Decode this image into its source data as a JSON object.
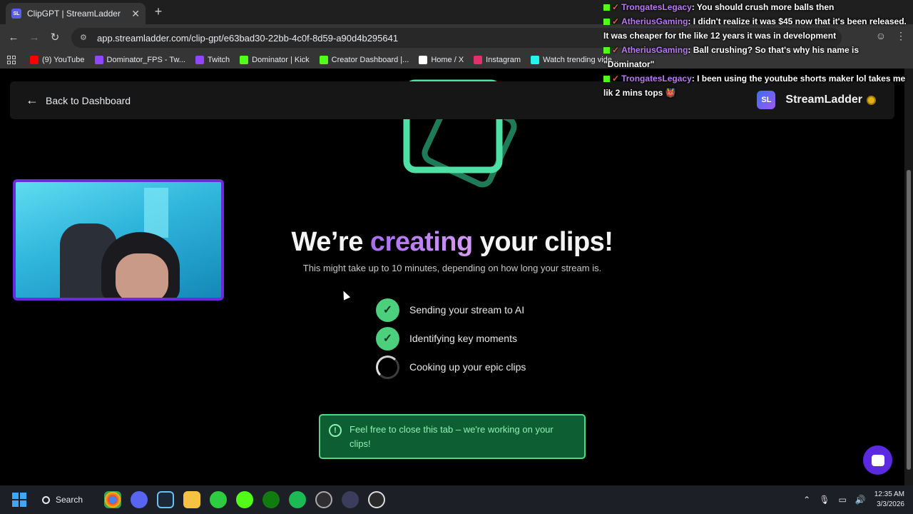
{
  "browser": {
    "tab_title": "ClipGPT | StreamLadder",
    "tab_favicon": "SL",
    "tab_close": "✕",
    "new_tab": "+",
    "url": "app.streamladder.com/clip-gpt/e63bad30-22bb-4c0f-8d59-a90d4b295641",
    "bookmarks": [
      {
        "label": "(9) YouTube",
        "color": "#ff0000"
      },
      {
        "label": "Dominator_FPS - Tw...",
        "color": "#9146ff"
      },
      {
        "label": "Twitch",
        "color": "#9146ff"
      },
      {
        "label": "Dominator | Kick",
        "color": "#53fc18"
      },
      {
        "label": "Creator Dashboard |...",
        "color": "#53fc18"
      },
      {
        "label": "Home / X",
        "color": "#ffffff"
      },
      {
        "label": "Instagram",
        "color": "#e1306c"
      },
      {
        "label": "Watch trending vide...",
        "color": "#25f4ee"
      }
    ]
  },
  "topbar": {
    "back_label": "Back to Dashboard",
    "brand_logo": "SL",
    "brand_name": "StreamLadder"
  },
  "main": {
    "headline_before": "We’re ",
    "headline_accent": "creating",
    "headline_after": " your clips!",
    "subtitle": "This might take up to 10 minutes, depending on how long your stream is.",
    "steps": [
      {
        "label": "Sending your stream to AI",
        "status": "done"
      },
      {
        "label": "Identifying key moments",
        "status": "done"
      },
      {
        "label": "Cooking up your epic clips",
        "status": "in-progress"
      }
    ],
    "notice": "Feel free to close this tab – we're working on your clips!"
  },
  "chat_overlay": [
    {
      "user": "TrongatesLegacy",
      "text": ": You should crush more balls then"
    },
    {
      "user": "AtheriusGaming",
      "text": ": I didn't realize it was $45 now that it's been released. It was cheaper for the like 12 years it was in development"
    },
    {
      "user": "AtheriusGaming",
      "text": ": Ball crushing? So that's why his name is \"Dominator\""
    },
    {
      "user": "TrongatesLegacy",
      "text": ": I been using the youtube shorts maker lol takes me lik 2 mins tops 👹"
    }
  ],
  "taskbar": {
    "search_label": "Search",
    "time": "12:35 AM",
    "date": "3/3/2026"
  },
  "colors": {
    "accent_purple": "#a86cf3",
    "success_green": "#4cd07d",
    "notice_bg": "#0e5e33"
  }
}
